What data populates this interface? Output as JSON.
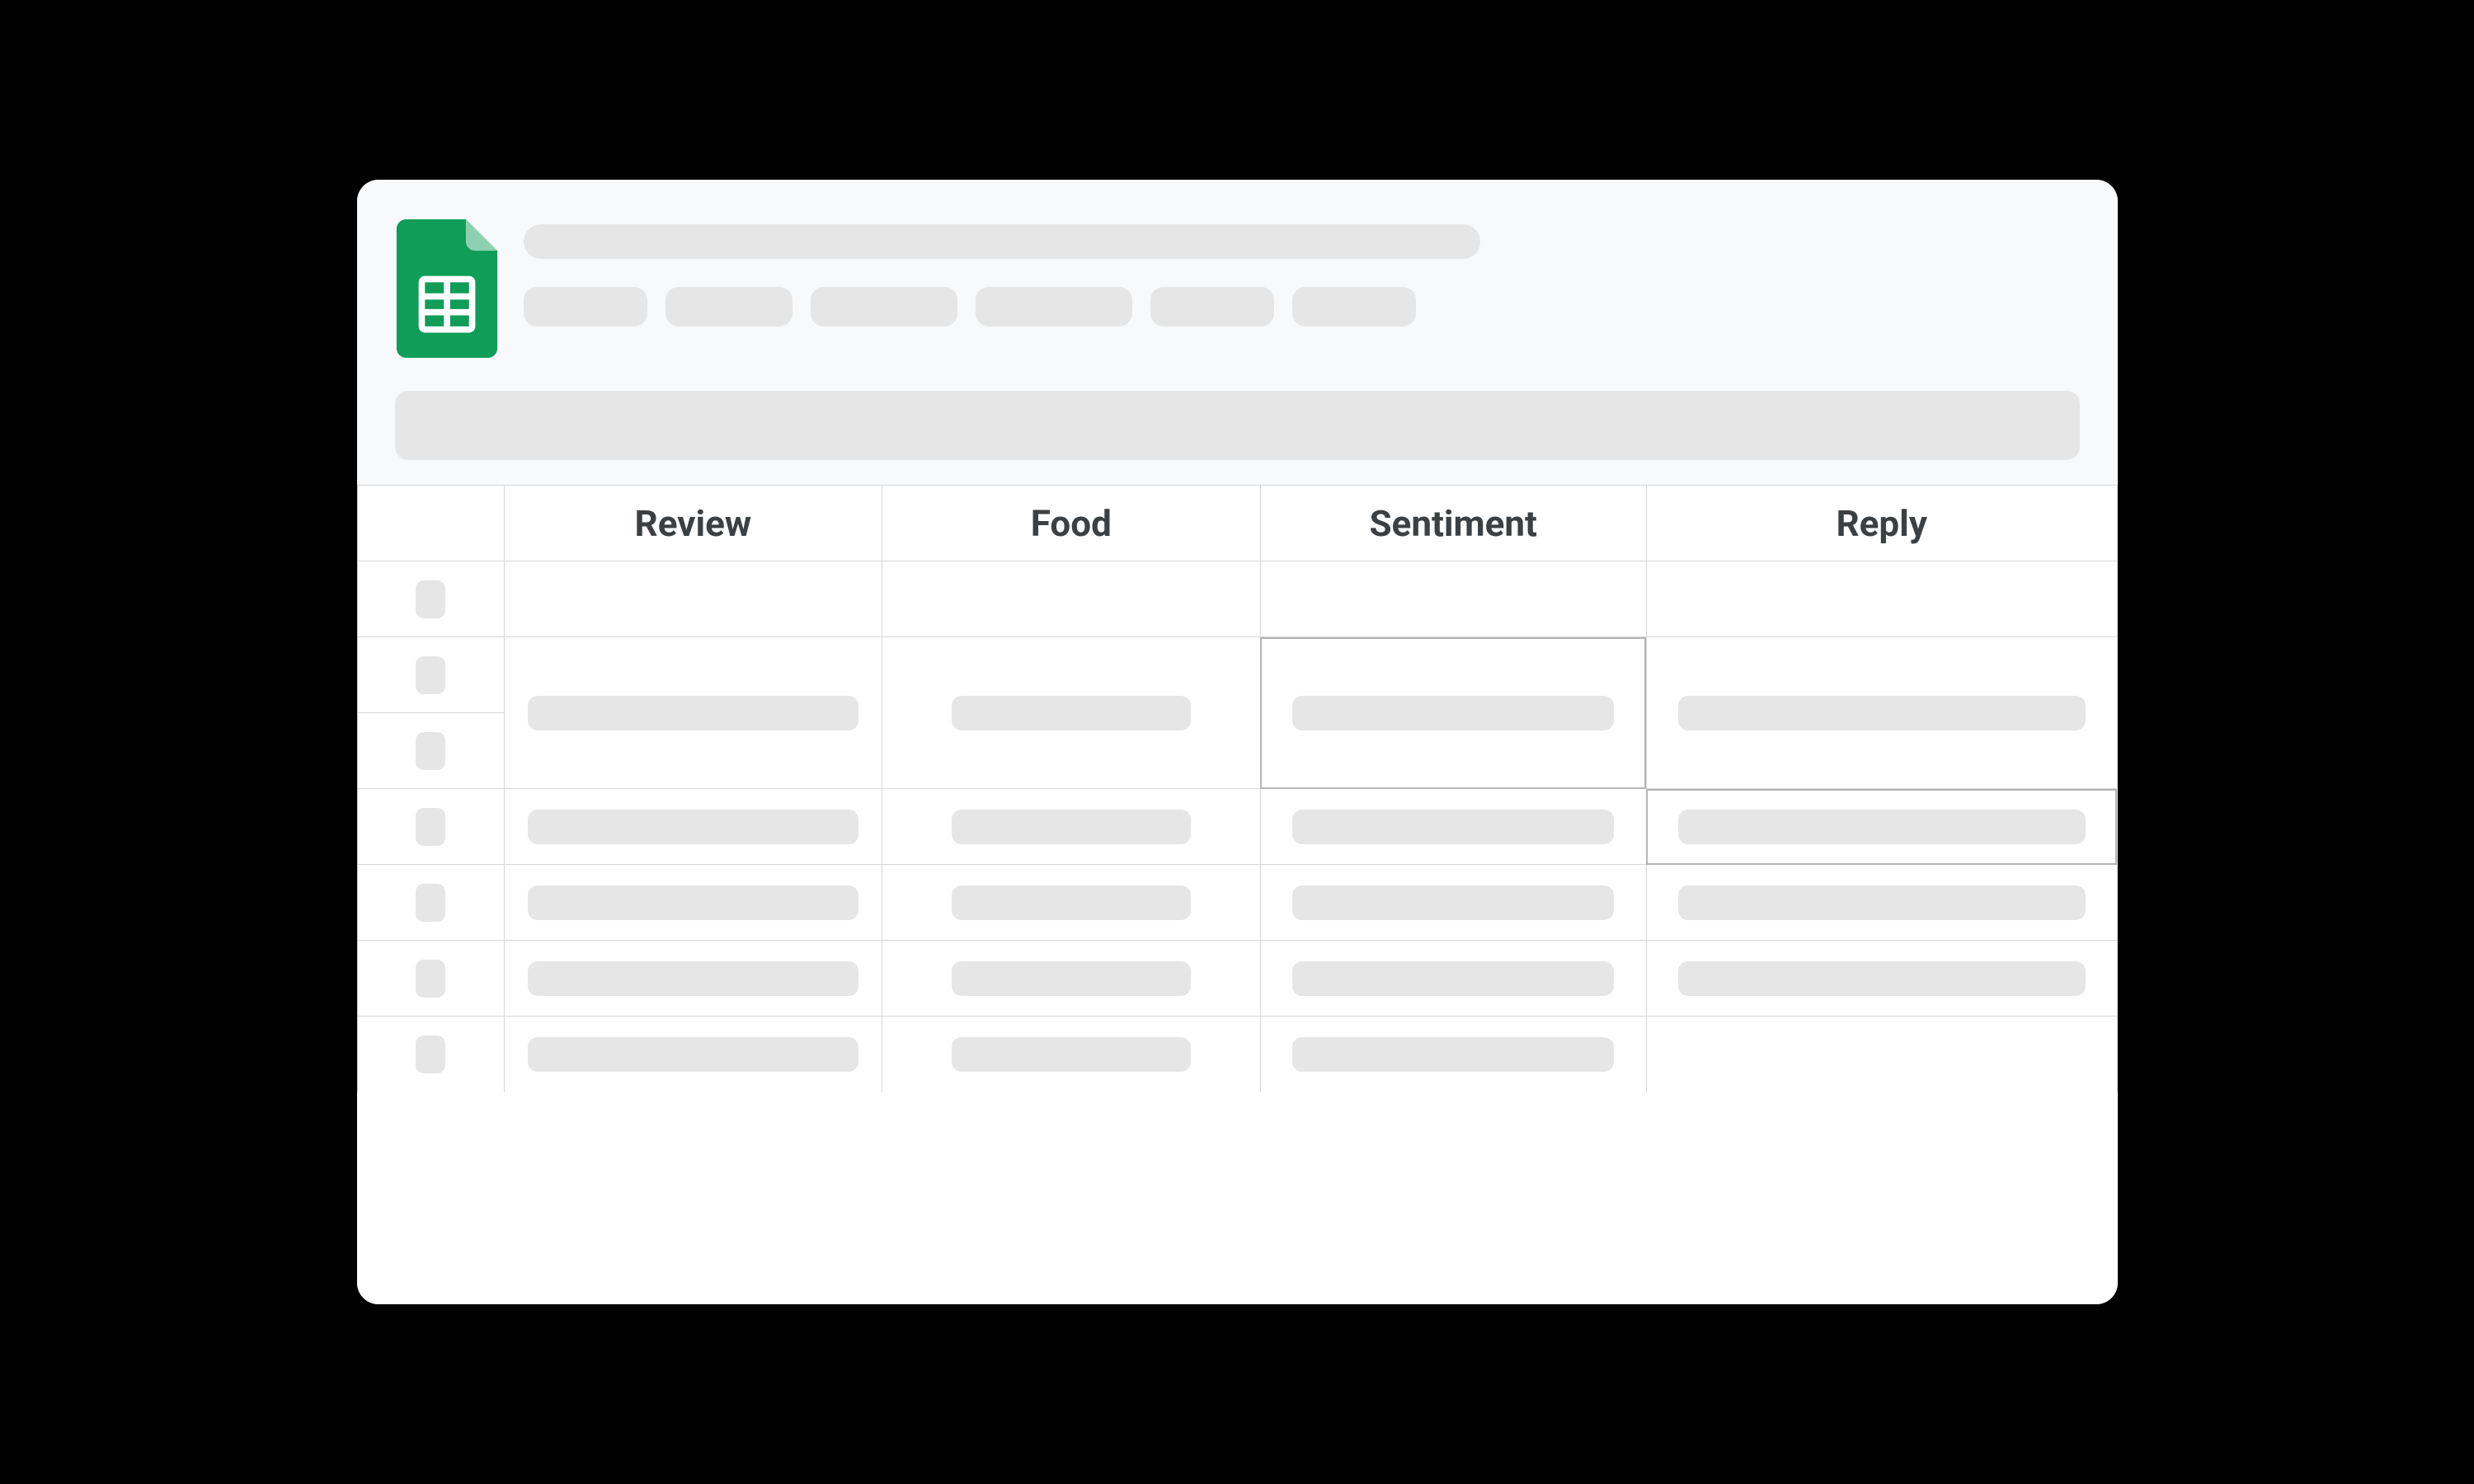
{
  "app": {
    "name": "Google Sheets"
  },
  "headers": {
    "col_a": "Review",
    "col_b": "Food",
    "col_c": "Sentiment",
    "col_d": "Reply"
  },
  "colors": {
    "brand_green": "#0f9d58",
    "placeholder": "#e6e6e6",
    "text": "#3c4043",
    "border": "#d7d7d7"
  }
}
